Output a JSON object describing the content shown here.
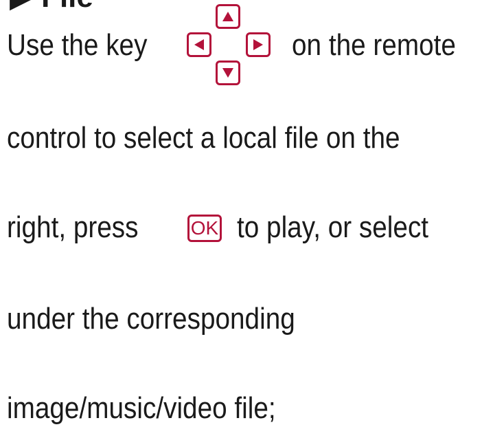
{
  "section": {
    "heading": "▶ File"
  },
  "text": {
    "line1_before": "Use the key",
    "line1_after": "on the remote",
    "line2": "control to select a local file on the",
    "line3_before": "right, press",
    "line3_after": "to play, or select",
    "line4": "under the corresponding",
    "line5": "image/music/video file;"
  },
  "keys": {
    "ok_label": "OK",
    "up_icon": "triangle-up",
    "down_icon": "triangle-down",
    "left_icon": "triangle-left",
    "right_icon": "triangle-right",
    "accent_color": "#b3123a"
  }
}
